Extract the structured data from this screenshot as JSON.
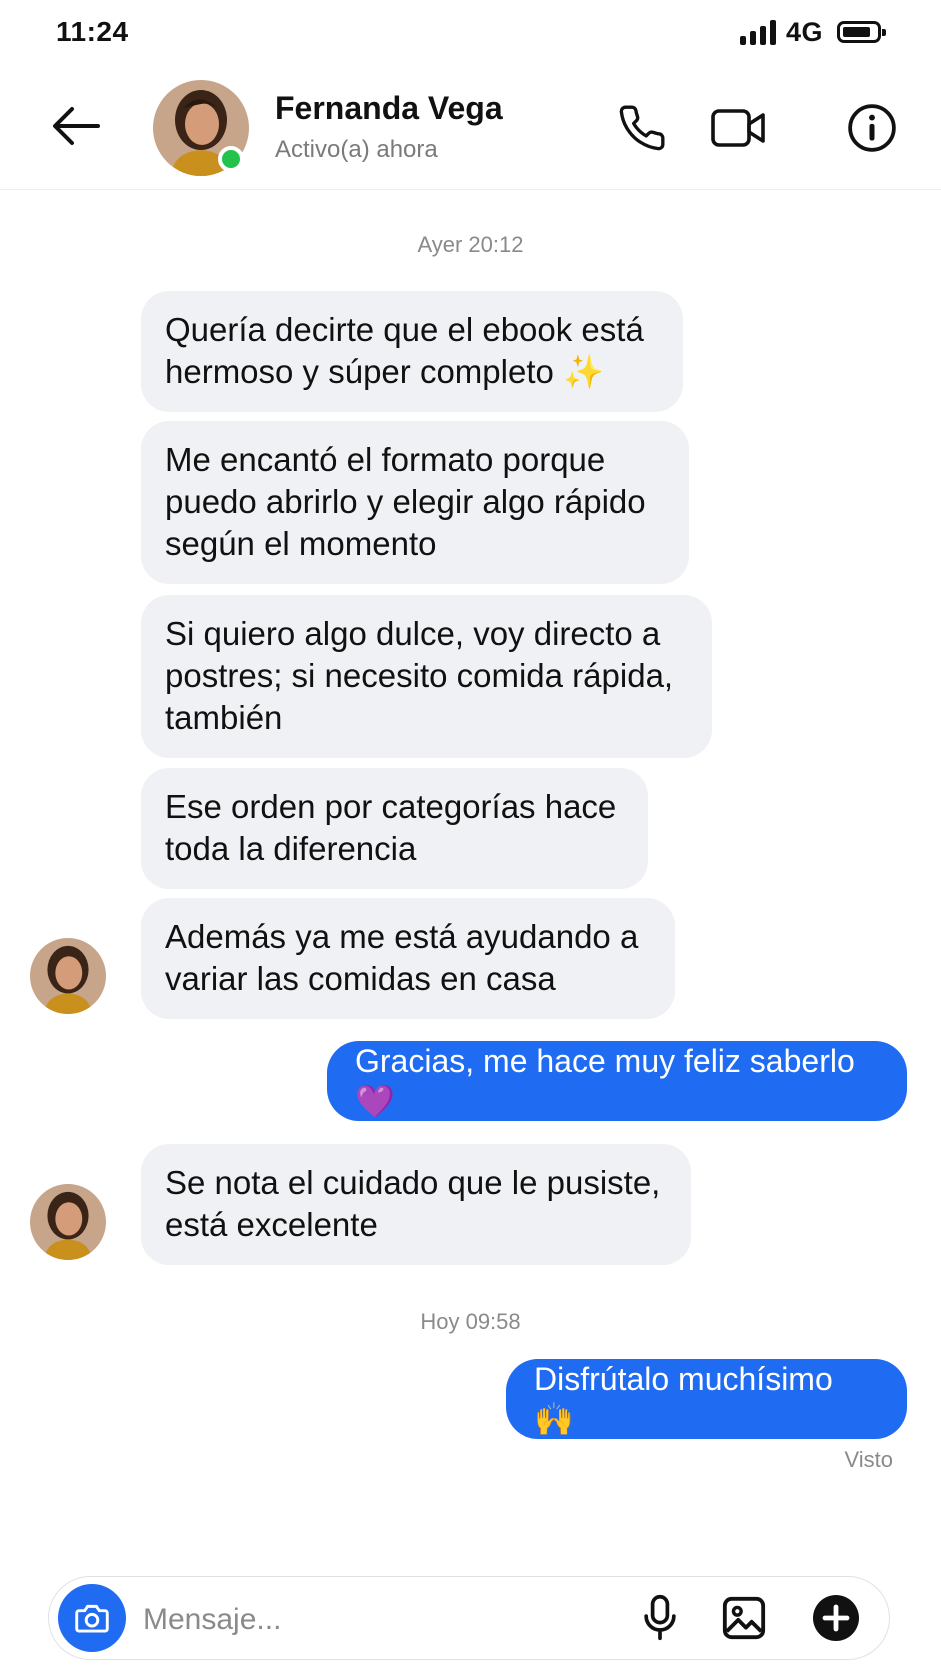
{
  "status_bar": {
    "time": "11:24",
    "network": "4G"
  },
  "header": {
    "contact_name": "Fernanda Vega",
    "presence": "Activo(a) ahora"
  },
  "chat": {
    "timestamp_1": "Ayer 20:12",
    "timestamp_2": "Hoy 09:58",
    "messages": [
      {
        "from": "contact",
        "text": "Quería decirte que el ebook está hermoso y súper completo ✨"
      },
      {
        "from": "contact",
        "text": "Me encantó el formato porque puedo abrirlo y elegir algo rápido según el momento"
      },
      {
        "from": "contact",
        "text": "Si quiero algo dulce, voy directo a postres; si necesito comida rápida, también"
      },
      {
        "from": "contact",
        "text": "Ese orden por categorías hace toda la diferencia"
      },
      {
        "from": "contact",
        "text": "Además ya me está ayudando a variar las comidas en casa"
      },
      {
        "from": "me",
        "text": "Gracias, me hace muy feliz saberlo 💜"
      },
      {
        "from": "contact",
        "text": "Se nota el cuidado que le pusiste, está excelente"
      },
      {
        "from": "me",
        "text": "Disfrútalo muchísimo 🙌"
      }
    ],
    "read_receipt": "Visto"
  },
  "composer": {
    "placeholder": "Mensaje..."
  },
  "colors": {
    "accent": "#1f6bf2",
    "incoming_bubble": "#f0f1f4",
    "online": "#23c24a"
  },
  "icons": [
    "back-arrow-icon",
    "phone-icon",
    "video-icon",
    "info-icon",
    "camera-icon",
    "microphone-icon",
    "image-icon",
    "plus-icon"
  ]
}
